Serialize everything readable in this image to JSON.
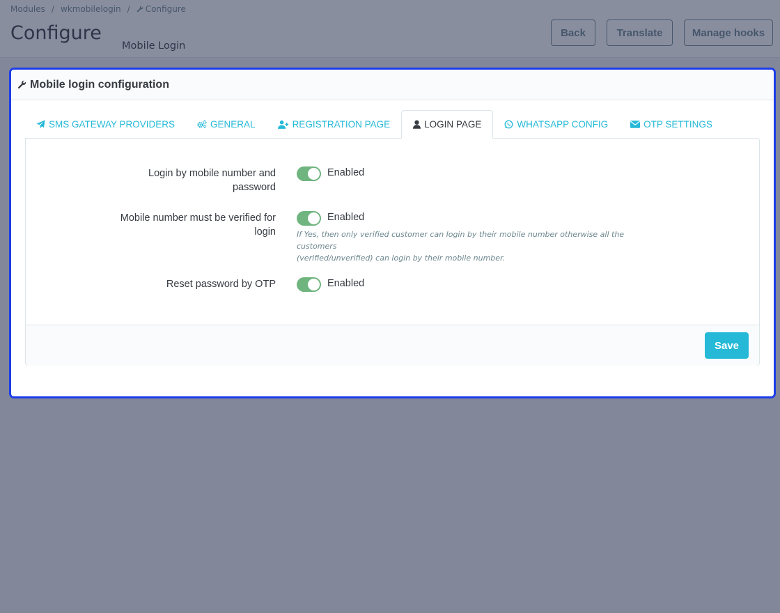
{
  "breadcrumb": {
    "items": [
      "Modules",
      "wkmobilelogin",
      "Configure"
    ]
  },
  "header": {
    "title": "Configure",
    "subtitle": "Mobile Login"
  },
  "toolbar": {
    "back_label": "Back",
    "translate_label": "Translate",
    "manage_hooks_label": "Manage hooks"
  },
  "panel": {
    "heading": "Mobile login configuration"
  },
  "tabs": [
    {
      "label": "SMS GATEWAY PROVIDERS",
      "icon": "paper-plane-icon"
    },
    {
      "label": "GENERAL",
      "icon": "gears-icon"
    },
    {
      "label": "REGISTRATION PAGE",
      "icon": "user-plus-icon"
    },
    {
      "label": "LOGIN PAGE",
      "icon": "user-icon",
      "active": true
    },
    {
      "label": "WHATSAPP CONFIG",
      "icon": "whatsapp-icon"
    },
    {
      "label": "OTP SETTINGS",
      "icon": "envelope-icon"
    }
  ],
  "form": {
    "rows": [
      {
        "label_line1": "Login by mobile number and",
        "label_line2": "password",
        "state": "Enabled"
      },
      {
        "label_line1": "Mobile number must be verified for",
        "label_line2": "login",
        "state": "Enabled",
        "help_line1": "If Yes, then only verified customer can login by their mobile number otherwise all the customers",
        "help_line2": "(verified/unverified) can login by their mobile number."
      },
      {
        "label_line1": "Reset password by OTP",
        "state": "Enabled"
      }
    ],
    "save_label": "Save"
  },
  "colors": {
    "accent": "#25b9d7",
    "switch_on": "#70b580",
    "focus_border": "#1d3de8",
    "overlay": "#7b8498"
  }
}
